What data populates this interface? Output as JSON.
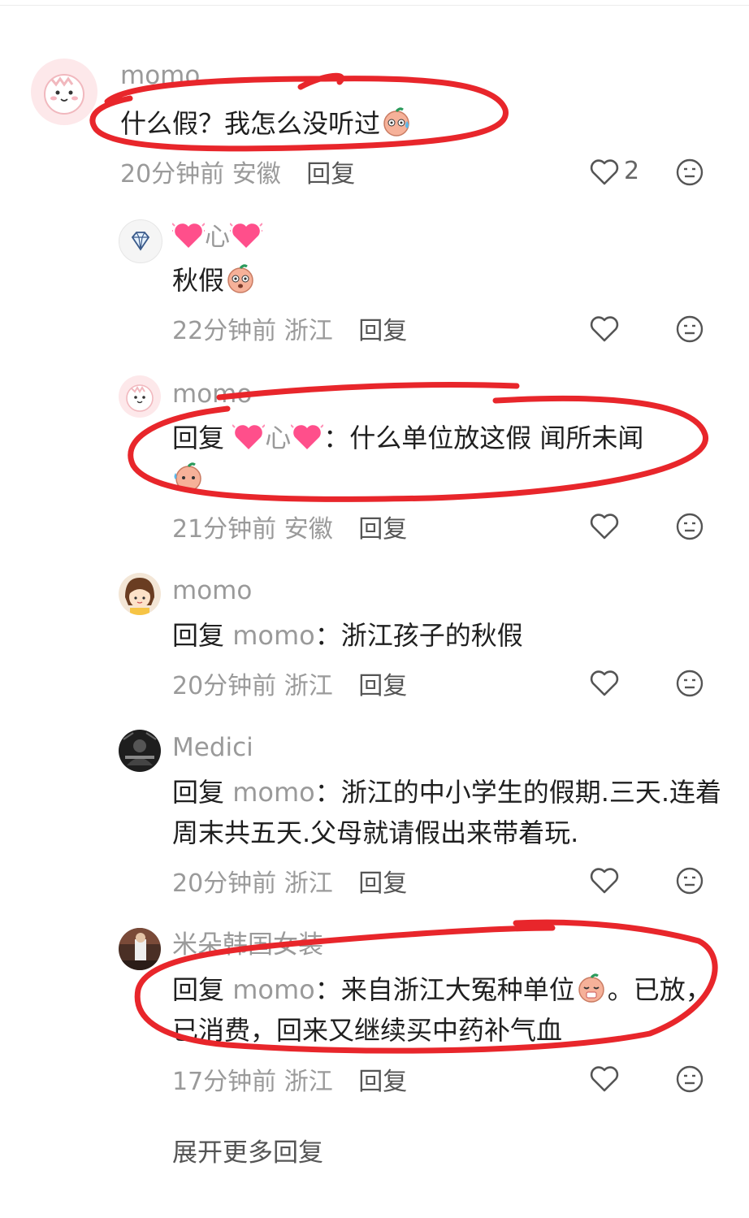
{
  "comments": [
    {
      "username": "momo",
      "text": "什么假？我怎么没听过",
      "time": "20分钟前",
      "location": "安徽",
      "reply_label": "回复",
      "likes": "2"
    },
    {
      "username": "心",
      "text": "秋假",
      "time": "22分钟前",
      "location": "浙江",
      "reply_label": "回复"
    },
    {
      "username": "momo",
      "reply_prefix": "回复",
      "mention": "心",
      "colon": "：",
      "text": "什么单位放这假 闻所未闻",
      "time": "21分钟前",
      "location": "安徽",
      "reply_label": "回复"
    },
    {
      "username": "momo",
      "reply_prefix": "回复",
      "mention": "momo",
      "colon": "：",
      "text": "浙江孩子的秋假",
      "time": "20分钟前",
      "location": "浙江",
      "reply_label": "回复"
    },
    {
      "username": "Medici",
      "reply_prefix": "回复",
      "mention": "momo",
      "colon": "：",
      "text": "浙江的中小学生的假期.三天.连着周末共五天.父母就请假出来带着玩.",
      "time": "20分钟前",
      "location": "浙江",
      "reply_label": "回复"
    },
    {
      "username": "米朵韩国女装",
      "reply_prefix": "回复",
      "mention": "momo",
      "colon": "：",
      "text_a": "来自浙江大冤种单位",
      "text_b": "。已放，已消费，回来又继续买中药补气血",
      "time": "17分钟前",
      "location": "浙江",
      "reply_label": "回复"
    }
  ],
  "expand_label": "展开更多回复",
  "colors": {
    "annotation_red": "#e8262b",
    "muted_text": "#9a9a9a",
    "heart_pink": "#ff4f8b"
  },
  "icons": [
    "heart-outline-icon",
    "neutral-face-icon",
    "diamond-badge-icon",
    "peach-emoji-icon",
    "pink-heart-emoji-icon"
  ]
}
